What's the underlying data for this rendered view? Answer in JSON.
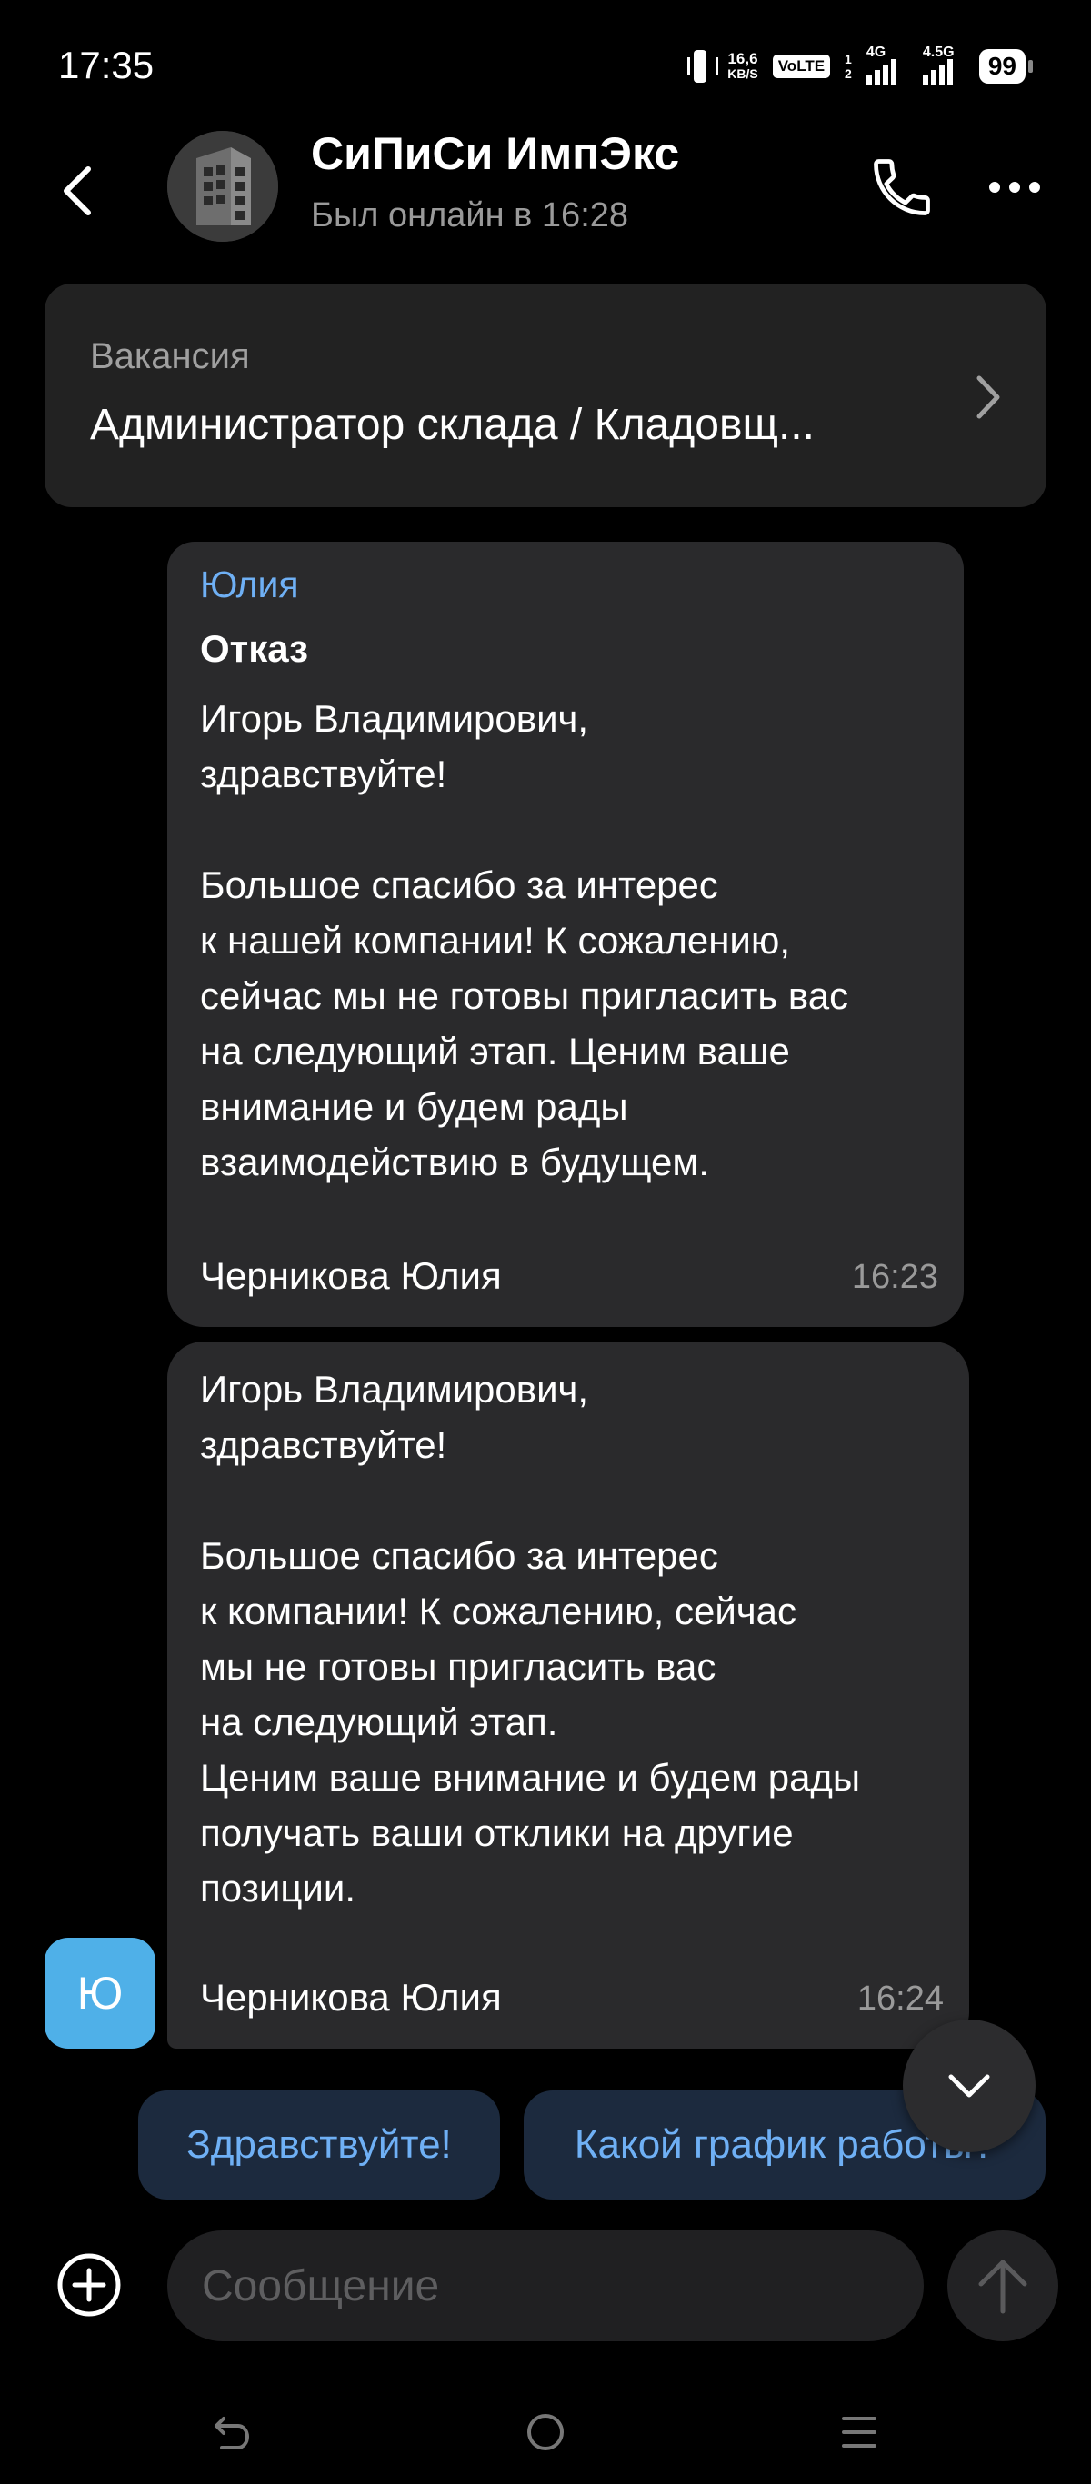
{
  "status_bar": {
    "time": "17:35",
    "net_speed_value": "16,6",
    "net_speed_unit": "KB/S",
    "volte": "VoLTE",
    "sim1_index": "1",
    "sim2_index": "2",
    "sim1_network": "4G",
    "sim2_network": "4.5G",
    "battery": "99"
  },
  "header": {
    "title": "СиПиСи ИмпЭкс",
    "subtitle": "Был онлайн в 16:28"
  },
  "vacancy": {
    "label": "Вакансия",
    "title": "Администратор склада / Кладовщ..."
  },
  "messages": [
    {
      "sender": "Юлия",
      "subject": "Отказ",
      "text": "Игорь Владимирович,\nздравствуйте!\n\nБольшое спасибо за интерес\nк нашей компании! К сожалению,\nсейчас мы не готовы пригласить вас\nна следующий этап. Ценим ваше\nвнимание и будем рады\nвзаимодействию в будущем.",
      "signature": "Черникова Юлия",
      "time": "16:23"
    },
    {
      "text": "Игорь Владимирович,\nздравствуйте!\n\nБольшое спасибо за интерес\nк компании! К сожалению, сейчас\nмы не готовы пригласить вас\nна следующий этап.\nЦеним ваше внимание и будем рады\nполучать ваши отклики на другие\nпозиции.",
      "signature": "Черникова Юлия",
      "time": "16:24"
    }
  ],
  "sender_avatar_letter": "Ю",
  "quick_replies": [
    "Здравствуйте!",
    "Какой график работы?"
  ],
  "input": {
    "placeholder": "Сообщение"
  },
  "colors": {
    "accent": "#6fb0f5",
    "bubble": "#2a2a2c",
    "card": "#222222",
    "avatar_letter_bg": "#4fb0e8",
    "chip_bg": "#1c2a3e"
  },
  "icons": {
    "back": "chevron-left-icon",
    "call": "phone-icon",
    "more": "more-horizontal-icon",
    "vacancy": "chevron-right-icon",
    "scroll": "chevron-down-icon",
    "add": "plus-circle-icon",
    "send": "arrow-up-icon"
  }
}
